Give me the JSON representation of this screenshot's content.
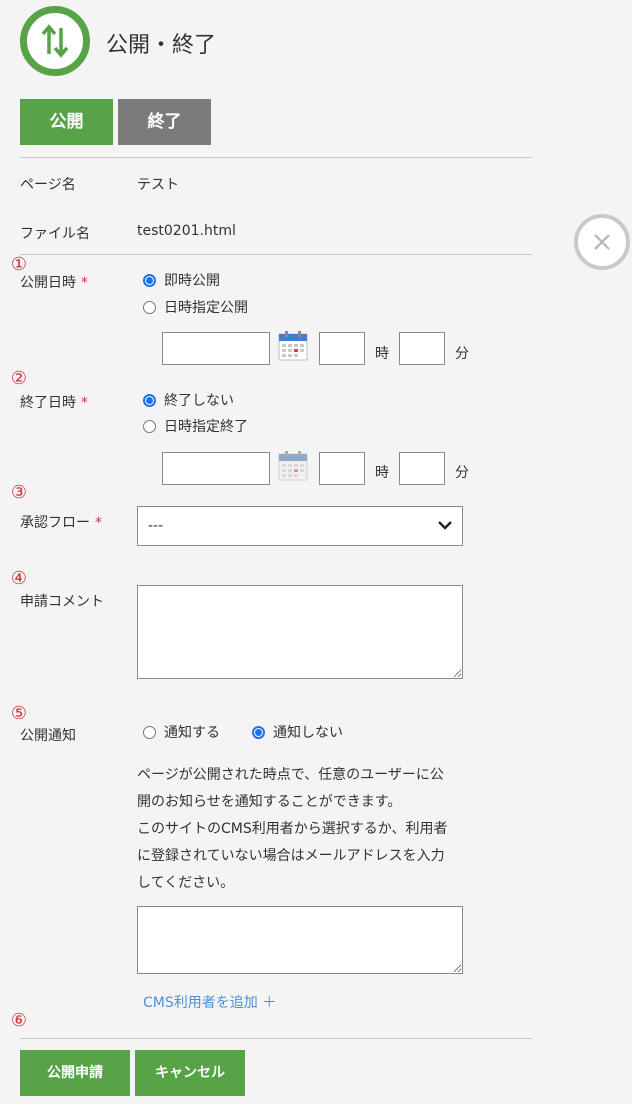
{
  "header": {
    "title": "公開・終了"
  },
  "tabs": [
    {
      "label": "公開",
      "active": true
    },
    {
      "label": "終了",
      "active": false
    }
  ],
  "page_info": {
    "page_name_label": "ページ名",
    "page_name_value": "テスト",
    "file_name_label": "ファイル名",
    "file_name_value": "test0201.html"
  },
  "markers": [
    "①",
    "②",
    "③",
    "④",
    "⑤",
    "⑥"
  ],
  "required_mark": "*",
  "publish_datetime": {
    "label": "公開日時",
    "options": [
      {
        "label": "即時公開",
        "selected": true
      },
      {
        "label": "日時指定公開",
        "selected": false
      }
    ],
    "date_value": "",
    "hour_value": "",
    "minute_value": "",
    "hour_unit": "時",
    "minute_unit": "分"
  },
  "end_datetime": {
    "label": "終了日時",
    "options": [
      {
        "label": "終了しない",
        "selected": true
      },
      {
        "label": "日時指定終了",
        "selected": false
      }
    ],
    "date_value": "",
    "hour_value": "",
    "minute_value": "",
    "hour_unit": "時",
    "minute_unit": "分"
  },
  "approval_flow": {
    "label": "承認フロー",
    "selected": "---"
  },
  "comment": {
    "label": "申請コメント",
    "value": ""
  },
  "notify": {
    "label": "公開通知",
    "options": [
      {
        "label": "通知する",
        "selected": false
      },
      {
        "label": "通知しない",
        "selected": true
      }
    ],
    "description_lines": [
      "ページが公開された時点で、任意のユーザーに公",
      "開のお知らせを通知することができます。",
      "このサイトのCMS利用者から選択するか、利用者",
      "に登録されていない場合はメールアドレスを入力",
      "してください。"
    ],
    "recipients_value": "",
    "add_user_link": "CMS利用者を追加 ＋"
  },
  "buttons": {
    "submit": "公開申請",
    "cancel": "キャンセル"
  },
  "colors": {
    "accent": "#58a248",
    "inactive_tab": "#7b7b7b",
    "required": "#d0303a",
    "link": "#4a90d9",
    "radio": "#1a73e8"
  },
  "icons": {
    "header": "up-down-arrows-icon",
    "calendar": "calendar-icon",
    "close": "close-icon",
    "chevron": "chevron-down-icon"
  }
}
